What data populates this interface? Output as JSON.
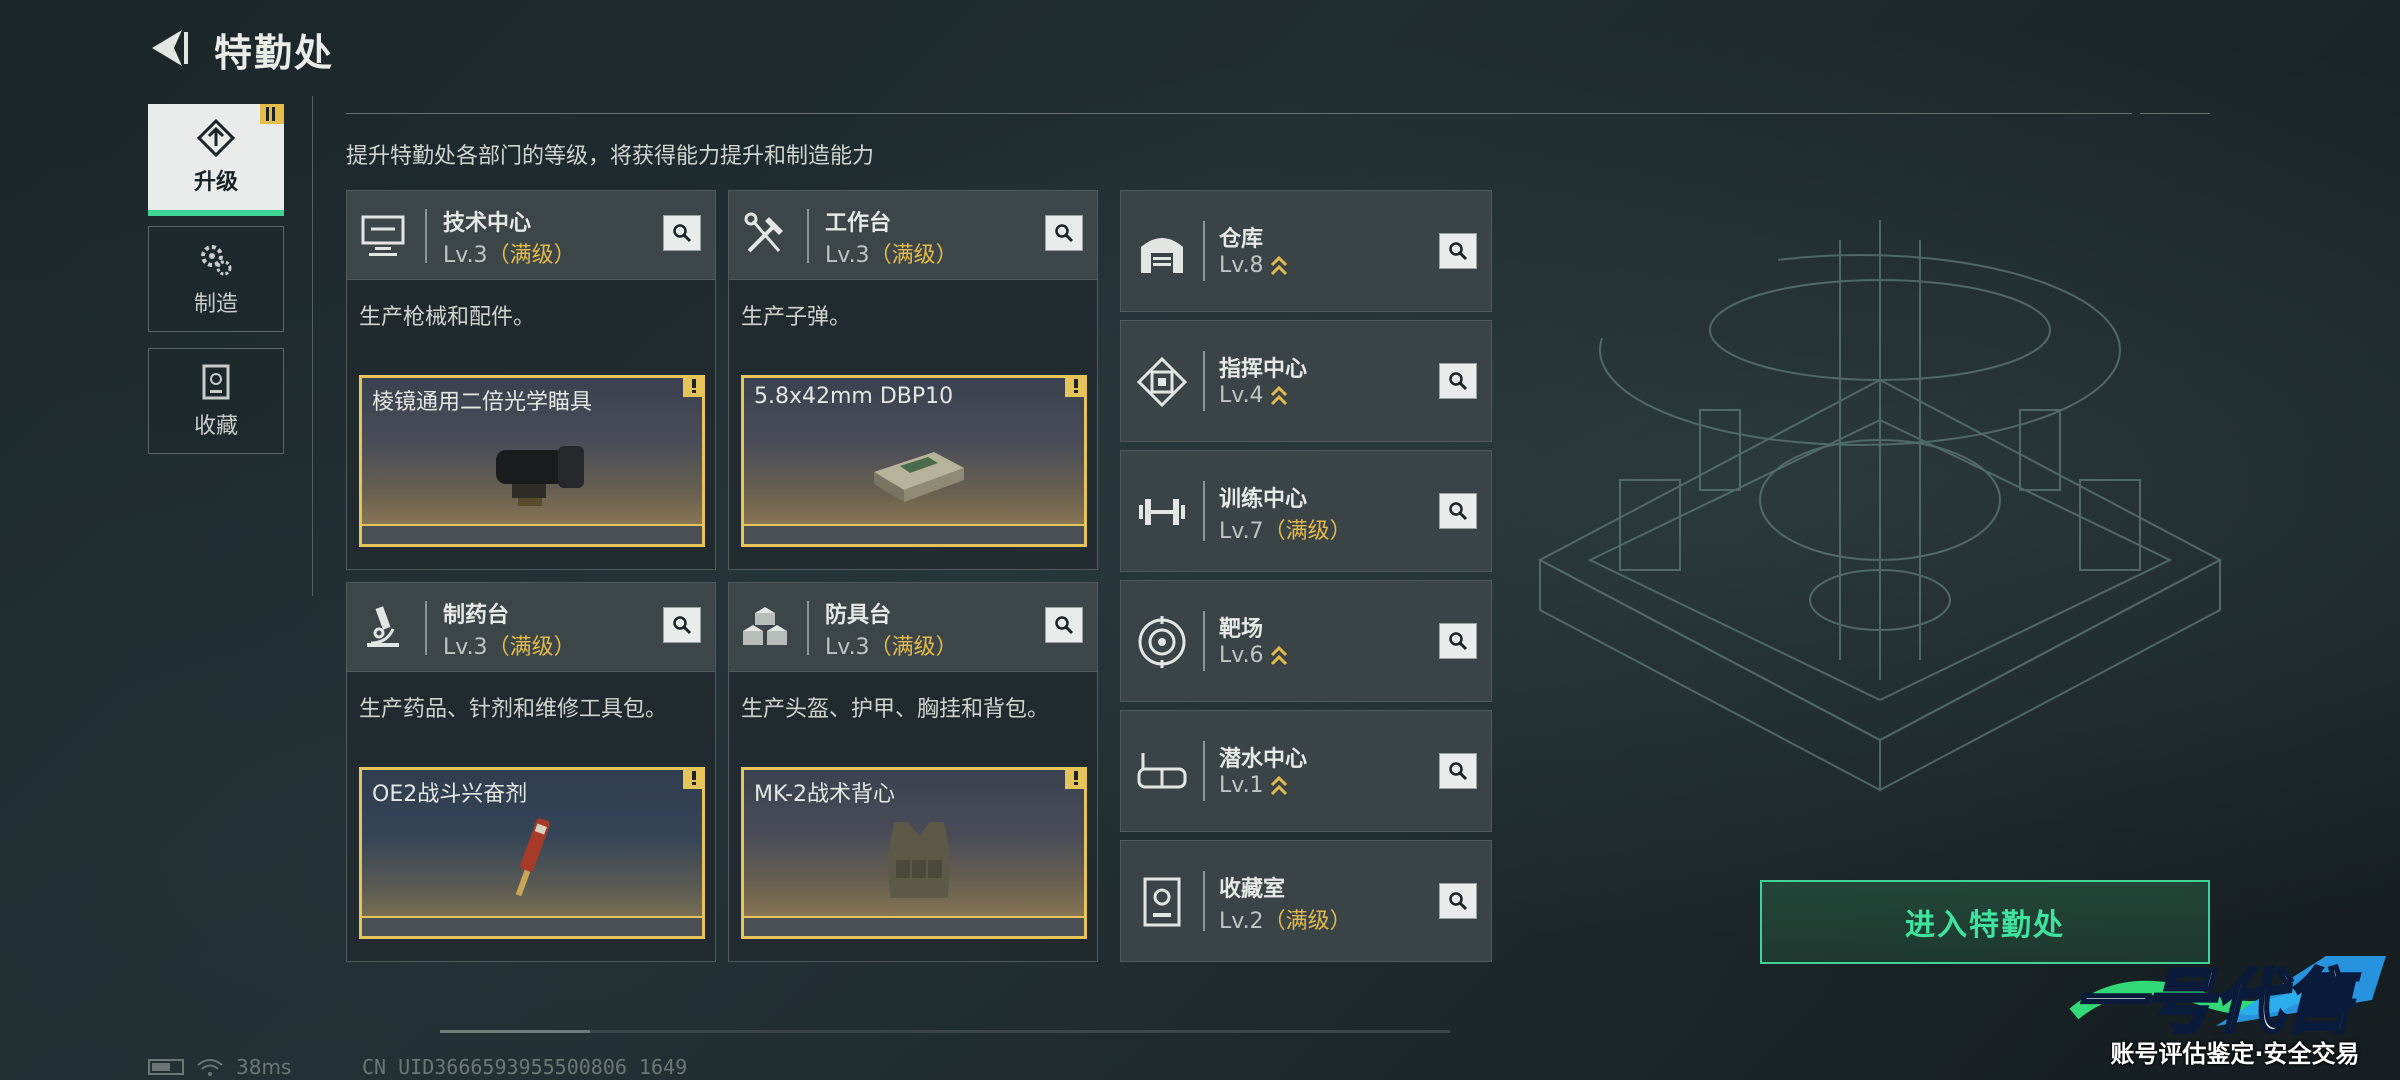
{
  "header": {
    "title": "特勤处"
  },
  "tabs": [
    {
      "label": "升级",
      "active": true
    },
    {
      "label": "制造",
      "active": false
    },
    {
      "label": "收藏",
      "active": false
    }
  ],
  "subtitle": "提升特勤处各部门的等级，将获得能力提升和制造能力",
  "cards": [
    {
      "name": "技术中心",
      "level": "Lv.3",
      "max": "（满级）",
      "desc": "生产枪械和配件。",
      "item": "棱镜通用二倍光学瞄具",
      "icon": "monitor-icon"
    },
    {
      "name": "工作台",
      "level": "Lv.3",
      "max": "（满级）",
      "desc": "生产子弹。",
      "item": "5.8x42mm DBP10",
      "icon": "tools-icon"
    },
    {
      "name": "制药台",
      "level": "Lv.3",
      "max": "（满级）",
      "desc": "生产药品、针剂和维修工具包。",
      "item": "OE2战斗兴奋剂",
      "icon": "microscope-icon"
    },
    {
      "name": "防具台",
      "level": "Lv.3",
      "max": "（满级）",
      "desc": "生产头盔、护甲、胸挂和背包。",
      "item": "MK-2战术背心",
      "icon": "cubes-icon"
    }
  ],
  "facilities": [
    {
      "name": "仓库",
      "level": "Lv.8",
      "max": "",
      "icon": "warehouse-icon"
    },
    {
      "name": "指挥中心",
      "level": "Lv.4",
      "max": "",
      "icon": "command-icon"
    },
    {
      "name": "训练中心",
      "level": "Lv.7",
      "max": "（满级）",
      "icon": "dumbbell-icon"
    },
    {
      "name": "靶场",
      "level": "Lv.6",
      "max": "",
      "icon": "target-icon"
    },
    {
      "name": "潜水中心",
      "level": "Lv.1",
      "max": "",
      "icon": "goggles-icon"
    },
    {
      "name": "收藏室",
      "level": "Lv.2",
      "max": "（满级）",
      "icon": "vault-icon"
    }
  ],
  "enter_button": "进入特勤处",
  "footer": {
    "ping": "38ms",
    "uid": "CN UID3666593955500806 1649"
  },
  "watermark": {
    "brand": "一号代售",
    "tagline": "账号评估鉴定·安全交易"
  },
  "colors": {
    "accent_green": "#3fd395",
    "gold": "#e3b94b"
  }
}
